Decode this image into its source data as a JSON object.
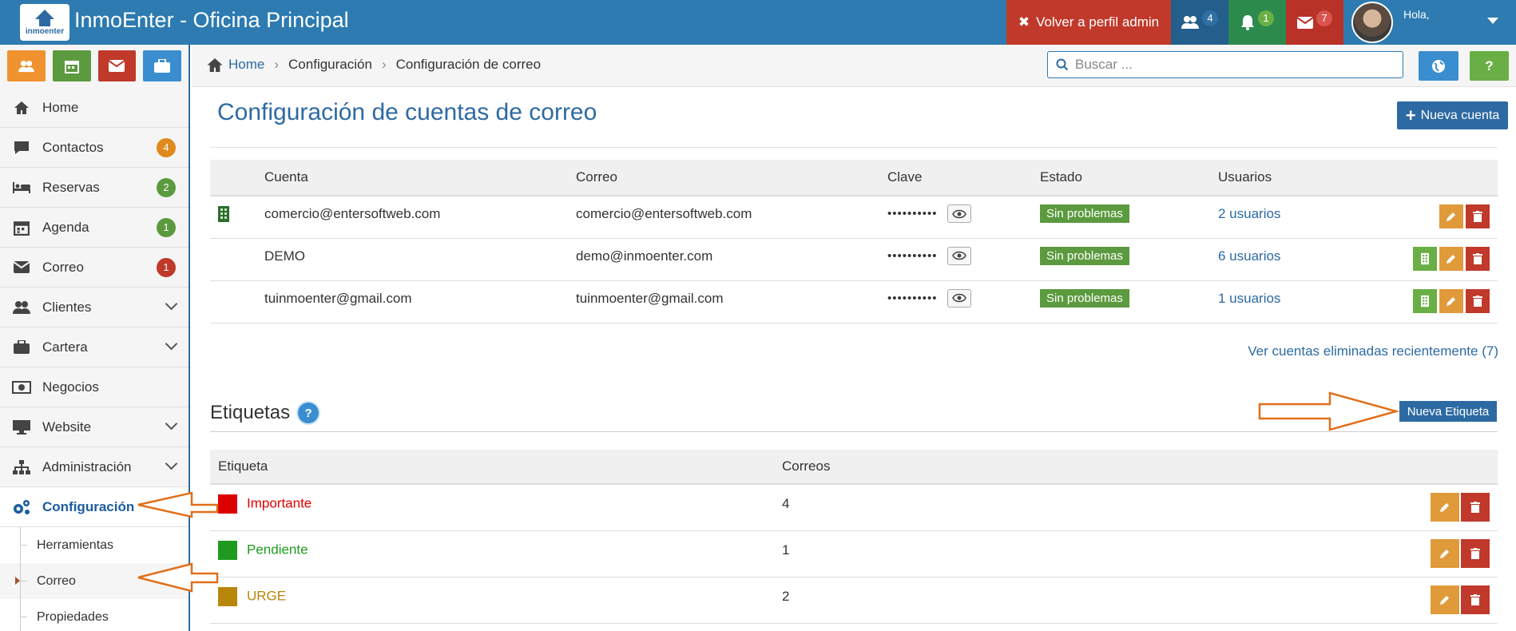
{
  "app": {
    "title": "InmoEnter - Oficina Principal",
    "logo_text": "inmoenter"
  },
  "topbar": {
    "admin_label": "Volver a perfil admin",
    "users_count": "4",
    "notifications_count": "1",
    "messages_count": "7",
    "greeting": "Hola,",
    "colors": {
      "bar": "#2d7bb0",
      "admin": "#c0392b",
      "users": "#235e8c",
      "bell": "#2c8a4d",
      "mail": "#b83228"
    }
  },
  "quick_buttons": [
    {
      "icon": "users-icon",
      "color": "#f0922d"
    },
    {
      "icon": "calendar-icon",
      "color": "#5b9a3e"
    },
    {
      "icon": "envelope-icon",
      "color": "#c0392b"
    },
    {
      "icon": "briefcase-icon",
      "color": "#3a8ed0"
    }
  ],
  "sidebar": {
    "items": [
      {
        "label": "Home",
        "icon": "home-icon"
      },
      {
        "label": "Contactos",
        "icon": "comment-icon",
        "badge": "4",
        "badge_color": "#e08a1e"
      },
      {
        "label": "Reservas",
        "icon": "bed-icon",
        "badge": "2",
        "badge_color": "#5b9a3e"
      },
      {
        "label": "Agenda",
        "icon": "calendar-icon",
        "badge": "1",
        "badge_color": "#5b9a3e"
      },
      {
        "label": "Correo",
        "icon": "envelope-icon",
        "badge": "1",
        "badge_color": "#c0392b"
      },
      {
        "label": "Clientes",
        "icon": "users-icon"
      },
      {
        "label": "Cartera",
        "icon": "briefcase-icon"
      },
      {
        "label": "Negocios",
        "icon": "money-icon"
      },
      {
        "label": "Website",
        "icon": "monitor-icon"
      },
      {
        "label": "Administración",
        "icon": "sitemap-icon"
      },
      {
        "label": "Configuración",
        "icon": "cogs-icon"
      }
    ],
    "subitems": [
      {
        "label": "Herramientas"
      },
      {
        "label": "Correo"
      },
      {
        "label": "Propiedades"
      }
    ]
  },
  "breadcrumb": {
    "home": "Home",
    "level1": "Configuración",
    "level2": "Configuración de correo"
  },
  "search": {
    "placeholder": "Buscar ..."
  },
  "help_label": "?",
  "page": {
    "title": "Configuración de cuentas de correo",
    "new_account": "Nueva cuenta"
  },
  "accounts": {
    "headers": {
      "account": "Cuenta",
      "email": "Correo",
      "password": "Clave",
      "status": "Estado",
      "users": "Usuarios"
    },
    "rows": [
      {
        "account": "comercio@entersoftweb.com",
        "email": "comercio@entersoftweb.com",
        "password": "••••••••••",
        "status": "Sin problemas",
        "users": "2 usuarios"
      },
      {
        "account": "DEMO",
        "email": "demo@inmoenter.com",
        "password": "••••••••••",
        "status": "Sin problemas",
        "users": "6 usuarios"
      },
      {
        "account": "tuinmoenter@gmail.com",
        "email": "tuinmoenter@gmail.com",
        "password": "••••••••••",
        "status": "Sin problemas",
        "users": "1 usuarios"
      }
    ],
    "deleted_link": "Ver cuentas eliminadas recientemente (7)"
  },
  "labels": {
    "title": "Etiquetas",
    "help": "?",
    "new_label": "Nueva Etiqueta",
    "headers": {
      "label": "Etiqueta",
      "count": "Correos"
    },
    "rows": [
      {
        "name": "Importante",
        "count": "4",
        "color": "#dd0000"
      },
      {
        "name": "Pendiente",
        "count": "1",
        "color": "#1f9a1f"
      },
      {
        "name": "URGE",
        "count": "2",
        "color": "#b8860b"
      }
    ]
  }
}
